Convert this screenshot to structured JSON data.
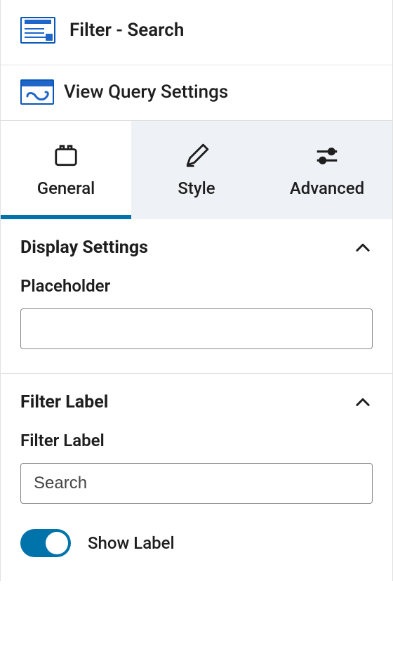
{
  "header": {
    "block_title": "Filter - Search",
    "query_link": "View Query Settings"
  },
  "tabs": {
    "general": "General",
    "style": "Style",
    "advanced": "Advanced",
    "active": "general"
  },
  "sections": {
    "display_settings": {
      "title": "Display Settings",
      "expanded": true,
      "placeholder_label": "Placeholder",
      "placeholder_value": ""
    },
    "filter_label": {
      "title": "Filter Label",
      "expanded": true,
      "field_label": "Filter Label",
      "field_value": "Search",
      "show_label_text": "Show Label",
      "show_label_on": true
    }
  }
}
